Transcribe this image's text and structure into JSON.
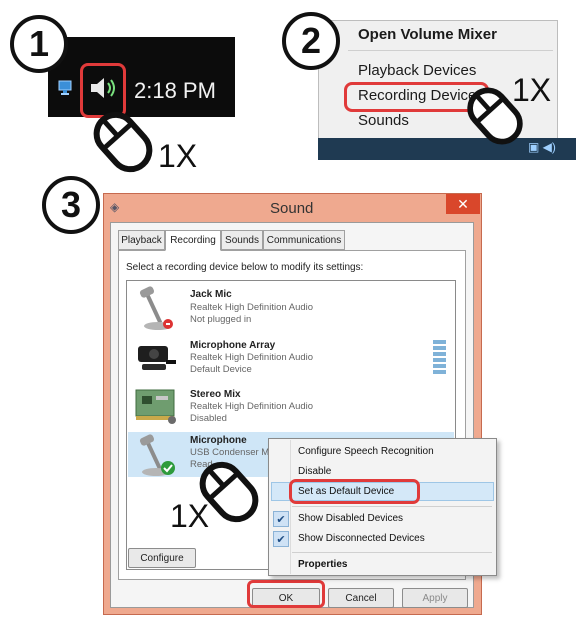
{
  "steps": [
    {
      "number": "1",
      "clicks": "1X"
    },
    {
      "number": "2",
      "clicks": "1X"
    },
    {
      "number": "3",
      "clicks": "1X"
    }
  ],
  "panel1": {
    "time": "2:18 PM"
  },
  "panel2": {
    "menu": [
      "Open Volume Mixer",
      "Playback Devices",
      "Recording Devices",
      "Sounds"
    ],
    "highlighted": "Recording Devices"
  },
  "panel3": {
    "window_title": "Sound",
    "close_label": "✕",
    "tabs": [
      "Playback",
      "Recording",
      "Sounds",
      "Communications"
    ],
    "active_tab": "Recording",
    "instruction": "Select a recording device below to modify its settings:",
    "devices": [
      {
        "name": "Jack Mic",
        "driver": "Realtek High Definition Audio",
        "status": "Not plugged in",
        "icon": "microphone-icon"
      },
      {
        "name": "Microphone Array",
        "driver": "Realtek High Definition Audio",
        "status": "Default Device",
        "icon": "webcam-microphone-icon"
      },
      {
        "name": "Stereo Mix",
        "driver": "Realtek High Definition Audio",
        "status": "Disabled",
        "icon": "sound-card-icon"
      },
      {
        "name": "Microphone",
        "driver": "USB Condenser M",
        "status": "Read",
        "icon": "microphone-icon",
        "selected": true
      }
    ],
    "context_menu": {
      "items": [
        "Configure Speech Recognition",
        "Disable",
        "Set as Default Device",
        "Show Disabled Devices",
        "Show Disconnected Devices",
        "Properties"
      ],
      "highlighted": "Set as Default Device",
      "checked": [
        "Show Disabled Devices",
        "Show Disconnected Devices"
      ]
    },
    "buttons": {
      "configure": "Configure",
      "ok": "OK",
      "cancel": "Cancel",
      "apply": "Apply"
    }
  },
  "colors": {
    "highlight_outline": "#e03a3a",
    "window_frame": "#efa98f",
    "selection": "#cfe6f7",
    "taskbar": "#0c0c0c"
  }
}
